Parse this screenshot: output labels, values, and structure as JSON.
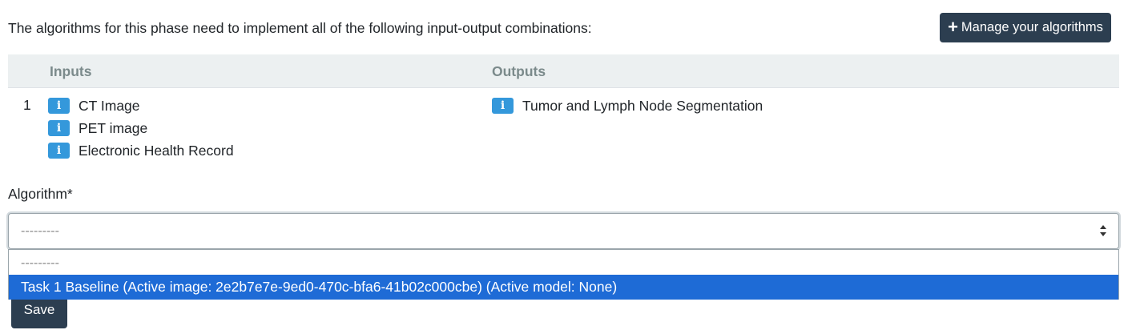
{
  "intro_text": "The algorithms for this phase need to implement all of the following input-output combinations:",
  "manage_button": {
    "icon": "plus-icon",
    "label": "Manage your algorithms"
  },
  "table": {
    "headers": {
      "inputs": "Inputs",
      "outputs": "Outputs"
    },
    "rows": [
      {
        "number": "1",
        "inputs": [
          "CT Image",
          "PET image",
          "Electronic Health Record"
        ],
        "outputs": [
          "Tumor and Lymph Node Segmentation"
        ]
      }
    ]
  },
  "info_icon_glyph": "i",
  "algorithm_field": {
    "label": "Algorithm*",
    "current_value": "---------",
    "options": [
      {
        "label": "---------",
        "highlighted": false
      },
      {
        "label": "Task 1 Baseline (Active image: 2e2b7e7e-9ed0-470c-bfa6-41b02c000cbe) (Active model: None)",
        "highlighted": true
      }
    ]
  },
  "save_button": {
    "label": "Save"
  },
  "colors": {
    "primary_dark": "#2c3e50",
    "info_badge": "#3498db",
    "table_header_bg": "#ecf0f1",
    "table_header_text": "#7b8a8b",
    "option_highlight": "#1e6bd6"
  }
}
